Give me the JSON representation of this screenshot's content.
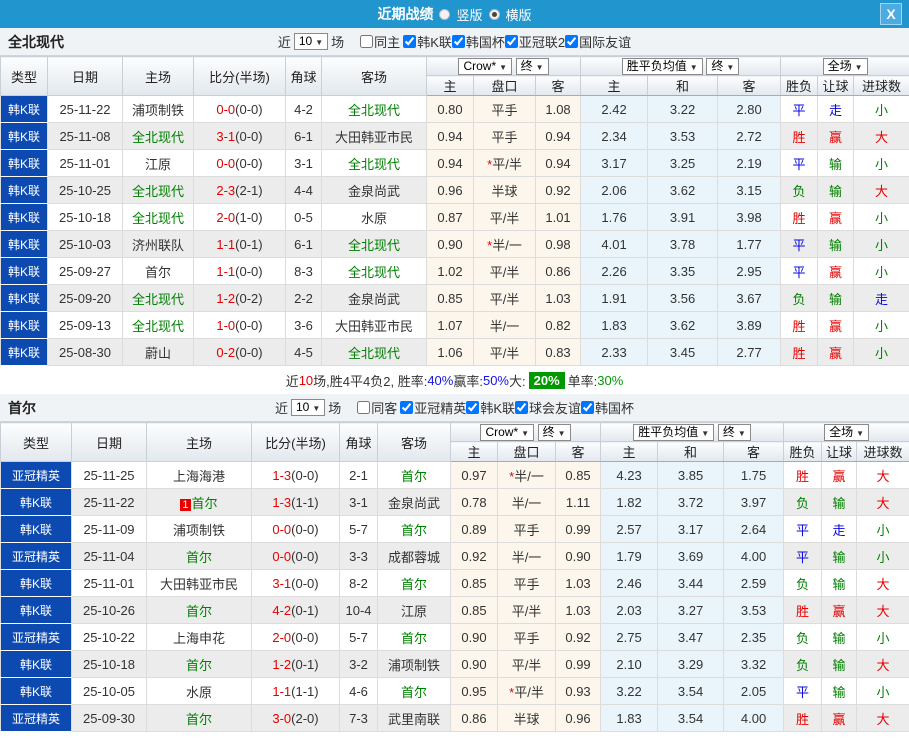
{
  "titlebar": {
    "title": "近期战绩",
    "vertical_label": "竖版",
    "horizontal_label": "横版",
    "close_label": "X"
  },
  "icons": {
    "dropdown_arrow": "▼"
  },
  "filter_words": {
    "near": "近",
    "games": "场"
  },
  "table_header": {
    "static_cols": [
      "类型",
      "日期",
      "主场",
      "比分(半场)",
      "角球",
      "客场"
    ],
    "crow_dd": "Crow*",
    "crow_final_dd": "终",
    "avg_dd": "胜平负均值",
    "avg_final_dd": "终",
    "scope_dd": "全场",
    "sub_cols": [
      "主",
      "盘口",
      "客",
      "主",
      "和",
      "客",
      "胜负",
      "让球",
      "进球数"
    ]
  },
  "sections": [
    {
      "team": "全北现代",
      "filter": {
        "count": "10",
        "same_label": "同主",
        "same_checked": false,
        "leagues": [
          {
            "label": "韩K联",
            "checked": true
          },
          {
            "label": "韩国杯",
            "checked": true
          },
          {
            "label": "亚冠联2",
            "checked": true
          },
          {
            "label": "国际友谊",
            "checked": true
          }
        ]
      },
      "rows": [
        {
          "type": "韩K联",
          "date": "25-11-22",
          "home": {
            "name": "浦项制铁",
            "focal": false
          },
          "score": {
            "ft": "0-0",
            "ht": "(0-0)"
          },
          "corner": "4-2",
          "away": {
            "name": "全北现代",
            "focal": true
          },
          "crow": [
            "0.80",
            "平手",
            "1.08"
          ],
          "avg": [
            "2.42",
            "3.22",
            "2.80"
          ],
          "results": [
            [
              "平",
              "b"
            ],
            [
              "走",
              "b"
            ],
            [
              "小",
              "g"
            ]
          ]
        },
        {
          "type": "韩K联",
          "date": "25-11-08",
          "home": {
            "name": "全北现代",
            "focal": true
          },
          "score": {
            "ft": "3-1",
            "ht": "(0-0)"
          },
          "corner": "6-1",
          "away": {
            "name": "大田韩亚市民",
            "focal": false
          },
          "crow": [
            "0.94",
            "平手",
            "0.94"
          ],
          "avg": [
            "2.34",
            "3.53",
            "2.72"
          ],
          "results": [
            [
              "胜",
              "r"
            ],
            [
              "赢",
              "r"
            ],
            [
              "大",
              "r"
            ]
          ]
        },
        {
          "type": "韩K联",
          "date": "25-11-01",
          "home": {
            "name": "江原",
            "focal": false
          },
          "score": {
            "ft": "0-0",
            "ht": "(0-0)"
          },
          "corner": "3-1",
          "away": {
            "name": "全北现代",
            "focal": true
          },
          "crow": [
            "0.94",
            "*平/半",
            "0.94"
          ],
          "avg": [
            "3.17",
            "3.25",
            "2.19"
          ],
          "results": [
            [
              "平",
              "b"
            ],
            [
              "输",
              "g"
            ],
            [
              "小",
              "g"
            ]
          ]
        },
        {
          "type": "韩K联",
          "date": "25-10-25",
          "home": {
            "name": "全北现代",
            "focal": true
          },
          "score": {
            "ft": "2-3",
            "ht": "(2-1)"
          },
          "corner": "4-4",
          "away": {
            "name": "金泉尚武",
            "focal": false
          },
          "crow": [
            "0.96",
            "半球",
            "0.92"
          ],
          "avg": [
            "2.06",
            "3.62",
            "3.15"
          ],
          "results": [
            [
              "负",
              "g"
            ],
            [
              "输",
              "g"
            ],
            [
              "大",
              "r"
            ]
          ]
        },
        {
          "type": "韩K联",
          "date": "25-10-18",
          "home": {
            "name": "全北现代",
            "focal": true
          },
          "score": {
            "ft": "2-0",
            "ht": "(1-0)"
          },
          "corner": "0-5",
          "away": {
            "name": "水原",
            "focal": false
          },
          "crow": [
            "0.87",
            "平/半",
            "1.01"
          ],
          "avg": [
            "1.76",
            "3.91",
            "3.98"
          ],
          "results": [
            [
              "胜",
              "r"
            ],
            [
              "赢",
              "r"
            ],
            [
              "小",
              "g"
            ]
          ]
        },
        {
          "type": "韩K联",
          "date": "25-10-03",
          "home": {
            "name": "济州联队",
            "focal": false
          },
          "score": {
            "ft": "1-1",
            "ht": "(0-1)"
          },
          "corner": "6-1",
          "away": {
            "name": "全北现代",
            "focal": true
          },
          "crow": [
            "0.90",
            "*半/一",
            "0.98"
          ],
          "avg": [
            "4.01",
            "3.78",
            "1.77"
          ],
          "results": [
            [
              "平",
              "b"
            ],
            [
              "输",
              "g"
            ],
            [
              "小",
              "g"
            ]
          ]
        },
        {
          "type": "韩K联",
          "date": "25-09-27",
          "home": {
            "name": "首尔",
            "focal": false
          },
          "score": {
            "ft": "1-1",
            "ht": "(0-0)"
          },
          "corner": "8-3",
          "away": {
            "name": "全北现代",
            "focal": true
          },
          "crow": [
            "1.02",
            "平/半",
            "0.86"
          ],
          "avg": [
            "2.26",
            "3.35",
            "2.95"
          ],
          "results": [
            [
              "平",
              "b"
            ],
            [
              "赢",
              "r"
            ],
            [
              "小",
              "g"
            ]
          ]
        },
        {
          "type": "韩K联",
          "date": "25-09-20",
          "home": {
            "name": "全北现代",
            "focal": true
          },
          "score": {
            "ft": "1-2",
            "ht": "(0-2)"
          },
          "corner": "2-2",
          "away": {
            "name": "金泉尚武",
            "focal": false
          },
          "crow": [
            "0.85",
            "平/半",
            "1.03"
          ],
          "avg": [
            "1.91",
            "3.56",
            "3.67"
          ],
          "results": [
            [
              "负",
              "g"
            ],
            [
              "输",
              "g"
            ],
            [
              "走",
              "b"
            ]
          ]
        },
        {
          "type": "韩K联",
          "date": "25-09-13",
          "home": {
            "name": "全北现代",
            "focal": true
          },
          "score": {
            "ft": "1-0",
            "ht": "(0-0)"
          },
          "corner": "3-6",
          "away": {
            "name": "大田韩亚市民",
            "focal": false
          },
          "crow": [
            "1.07",
            "半/一",
            "0.82"
          ],
          "avg": [
            "1.83",
            "3.62",
            "3.89"
          ],
          "results": [
            [
              "胜",
              "r"
            ],
            [
              "赢",
              "r"
            ],
            [
              "小",
              "g"
            ]
          ]
        },
        {
          "type": "韩K联",
          "date": "25-08-30",
          "home": {
            "name": "蔚山",
            "focal": false
          },
          "score": {
            "ft": "0-2",
            "ht": "(0-0)"
          },
          "corner": "4-5",
          "away": {
            "name": "全北现代",
            "focal": true
          },
          "crow": [
            "1.06",
            "平/半",
            "0.83"
          ],
          "avg": [
            "2.33",
            "3.45",
            "2.77"
          ],
          "results": [
            [
              "胜",
              "r"
            ],
            [
              "赢",
              "r"
            ],
            [
              "小",
              "g"
            ]
          ]
        }
      ],
      "summary": [
        {
          "t": "近",
          "c": "k"
        },
        {
          "t": "10",
          "c": "r"
        },
        {
          "t": "场,胜4平4负2, 胜率:",
          "c": "k"
        },
        {
          "t": "40%",
          "c": "b"
        },
        {
          "t": " 赢率:",
          "c": "k"
        },
        {
          "t": "50%",
          "c": "b"
        },
        {
          "t": " 大:",
          "c": "k"
        },
        {
          "t": "20%",
          "c": "gbox"
        },
        {
          "t": " 单率:",
          "c": "k"
        },
        {
          "t": "30%",
          "c": "g"
        }
      ]
    },
    {
      "team": "首尔",
      "filter": {
        "count": "10",
        "same_label": "同客",
        "same_checked": false,
        "leagues": [
          {
            "label": "亚冠精英",
            "checked": true
          },
          {
            "label": "韩K联",
            "checked": true
          },
          {
            "label": "球会友谊",
            "checked": true
          },
          {
            "label": "韩国杯",
            "checked": true
          }
        ]
      },
      "rows": [
        {
          "type": "亚冠精英",
          "date": "25-11-25",
          "home": {
            "name": "上海海港",
            "focal": false
          },
          "score": {
            "ft": "1-3",
            "ht": "(0-0)"
          },
          "corner": "2-1",
          "away": {
            "name": "首尔",
            "focal": true
          },
          "crow": [
            "0.97",
            "*半/一",
            "0.85"
          ],
          "avg": [
            "4.23",
            "3.85",
            "1.75"
          ],
          "results": [
            [
              "胜",
              "r"
            ],
            [
              "赢",
              "r"
            ],
            [
              "大",
              "r"
            ]
          ]
        },
        {
          "type": "韩K联",
          "date": "25-11-22",
          "home": {
            "name": "首尔",
            "focal": true,
            "badge": "1"
          },
          "score": {
            "ft": "1-3",
            "ht": "(1-1)"
          },
          "corner": "3-1",
          "away": {
            "name": "金泉尚武",
            "focal": false
          },
          "crow": [
            "0.78",
            "半/一",
            "1.11"
          ],
          "avg": [
            "1.82",
            "3.72",
            "3.97"
          ],
          "results": [
            [
              "负",
              "g"
            ],
            [
              "输",
              "g"
            ],
            [
              "大",
              "r"
            ]
          ]
        },
        {
          "type": "韩K联",
          "date": "25-11-09",
          "home": {
            "name": "浦项制铁",
            "focal": false
          },
          "score": {
            "ft": "0-0",
            "ht": "(0-0)"
          },
          "corner": "5-7",
          "away": {
            "name": "首尔",
            "focal": true
          },
          "crow": [
            "0.89",
            "平手",
            "0.99"
          ],
          "avg": [
            "2.57",
            "3.17",
            "2.64"
          ],
          "results": [
            [
              "平",
              "b"
            ],
            [
              "走",
              "b"
            ],
            [
              "小",
              "g"
            ]
          ]
        },
        {
          "type": "亚冠精英",
          "date": "25-11-04",
          "home": {
            "name": "首尔",
            "focal": true
          },
          "score": {
            "ft": "0-0",
            "ht": "(0-0)"
          },
          "corner": "3-3",
          "away": {
            "name": "成都蓉城",
            "focal": false
          },
          "crow": [
            "0.92",
            "半/一",
            "0.90"
          ],
          "avg": [
            "1.79",
            "3.69",
            "4.00"
          ],
          "results": [
            [
              "平",
              "b"
            ],
            [
              "输",
              "g"
            ],
            [
              "小",
              "g"
            ]
          ]
        },
        {
          "type": "韩K联",
          "date": "25-11-01",
          "home": {
            "name": "大田韩亚市民",
            "focal": false
          },
          "score": {
            "ft": "3-1",
            "ht": "(0-0)"
          },
          "corner": "8-2",
          "away": {
            "name": "首尔",
            "focal": true
          },
          "crow": [
            "0.85",
            "平手",
            "1.03"
          ],
          "avg": [
            "2.46",
            "3.44",
            "2.59"
          ],
          "results": [
            [
              "负",
              "g"
            ],
            [
              "输",
              "g"
            ],
            [
              "大",
              "r"
            ]
          ]
        },
        {
          "type": "韩K联",
          "date": "25-10-26",
          "home": {
            "name": "首尔",
            "focal": true
          },
          "score": {
            "ft": "4-2",
            "ht": "(0-1)"
          },
          "corner": "10-4",
          "away": {
            "name": "江原",
            "focal": false
          },
          "crow": [
            "0.85",
            "平/半",
            "1.03"
          ],
          "avg": [
            "2.03",
            "3.27",
            "3.53"
          ],
          "results": [
            [
              "胜",
              "r"
            ],
            [
              "赢",
              "r"
            ],
            [
              "大",
              "r"
            ]
          ]
        },
        {
          "type": "亚冠精英",
          "date": "25-10-22",
          "home": {
            "name": "上海申花",
            "focal": false
          },
          "score": {
            "ft": "2-0",
            "ht": "(0-0)"
          },
          "corner": "5-7",
          "away": {
            "name": "首尔",
            "focal": true
          },
          "crow": [
            "0.90",
            "平手",
            "0.92"
          ],
          "avg": [
            "2.75",
            "3.47",
            "2.35"
          ],
          "results": [
            [
              "负",
              "g"
            ],
            [
              "输",
              "g"
            ],
            [
              "小",
              "g"
            ]
          ]
        },
        {
          "type": "韩K联",
          "date": "25-10-18",
          "home": {
            "name": "首尔",
            "focal": true
          },
          "score": {
            "ft": "1-2",
            "ht": "(0-1)"
          },
          "corner": "3-2",
          "away": {
            "name": "浦项制铁",
            "focal": false
          },
          "crow": [
            "0.90",
            "平/半",
            "0.99"
          ],
          "avg": [
            "2.10",
            "3.29",
            "3.32"
          ],
          "results": [
            [
              "负",
              "g"
            ],
            [
              "输",
              "g"
            ],
            [
              "大",
              "r"
            ]
          ]
        },
        {
          "type": "韩K联",
          "date": "25-10-05",
          "home": {
            "name": "水原",
            "focal": false
          },
          "score": {
            "ft": "1-1",
            "ht": "(1-1)"
          },
          "corner": "4-6",
          "away": {
            "name": "首尔",
            "focal": true
          },
          "crow": [
            "0.95",
            "*平/半",
            "0.93"
          ],
          "avg": [
            "3.22",
            "3.54",
            "2.05"
          ],
          "results": [
            [
              "平",
              "b"
            ],
            [
              "输",
              "g"
            ],
            [
              "小",
              "g"
            ]
          ]
        },
        {
          "type": "亚冠精英",
          "date": "25-09-30",
          "home": {
            "name": "首尔",
            "focal": true
          },
          "score": {
            "ft": "3-0",
            "ht": "(2-0)"
          },
          "corner": "7-3",
          "away": {
            "name": "武里南联",
            "focal": false
          },
          "crow": [
            "0.86",
            "半球",
            "0.96"
          ],
          "avg": [
            "1.83",
            "3.54",
            "4.00"
          ],
          "results": [
            [
              "胜",
              "r"
            ],
            [
              "赢",
              "r"
            ],
            [
              "大",
              "r"
            ]
          ]
        }
      ],
      "summary": null
    }
  ]
}
